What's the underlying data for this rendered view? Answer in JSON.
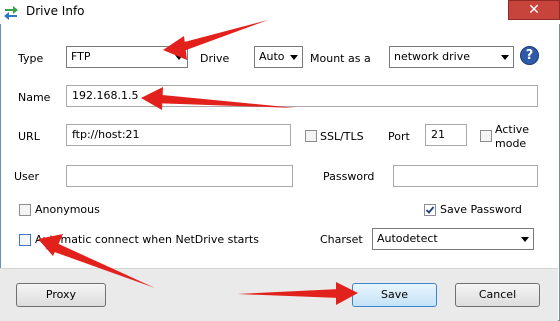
{
  "window": {
    "title": "Drive Info",
    "close_glyph": "✕",
    "icon": "netdrive-arrows-icon"
  },
  "form": {
    "type_label": "Type",
    "type_value": "FTP",
    "drive_label": "Drive",
    "drive_value": "Auto",
    "mount_label": "Mount as a",
    "mount_value": "network drive",
    "help_glyph": "?",
    "name_label": "Name",
    "name_value": "192.168.1.5",
    "url_label": "URL",
    "url_value": "ftp://host:21",
    "ssl_label": "SSL/TLS",
    "port_label": "Port",
    "port_value": "21",
    "active_mode_line1": "Active",
    "active_mode_line2": "mode",
    "user_label": "User",
    "user_value": "",
    "password_label": "Password",
    "password_value": "",
    "anonymous_label": "Anonymous",
    "save_password_label": "Save Password",
    "auto_connect_label": "Automatic connect when NetDrive starts",
    "charset_label": "Charset",
    "charset_value": "Autodetect"
  },
  "state": {
    "ssl_checked": false,
    "active_mode_checked": false,
    "anonymous_checked": false,
    "save_password_checked": true,
    "auto_connect_checked": false
  },
  "footer": {
    "proxy_label": "Proxy",
    "save_label": "Save",
    "cancel_label": "Cancel"
  },
  "annotation_color": "#e3211c"
}
